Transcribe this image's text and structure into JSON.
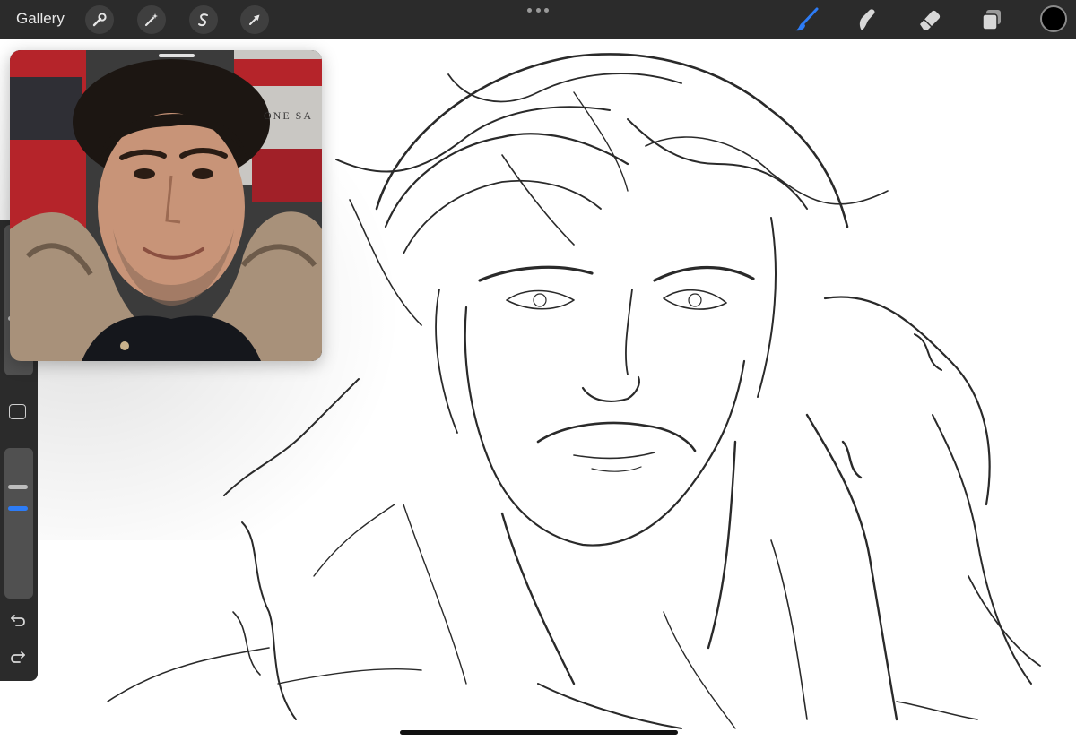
{
  "app": {
    "gallery_label": "Gallery"
  },
  "toolbar": {
    "left_tools": [
      {
        "name": "actions",
        "icon": "wrench-icon"
      },
      {
        "name": "adjustments",
        "icon": "magic-wand-icon"
      },
      {
        "name": "selection",
        "icon": "selection-s-icon"
      },
      {
        "name": "transform",
        "icon": "arrow-icon"
      }
    ],
    "right_tools": [
      {
        "name": "brush",
        "icon": "brush-icon",
        "active": true
      },
      {
        "name": "smudge",
        "icon": "smudge-icon"
      },
      {
        "name": "eraser",
        "icon": "eraser-icon"
      },
      {
        "name": "layers",
        "icon": "layers-icon"
      }
    ],
    "active_color": "#000000",
    "accent_color": "#2d7cf6"
  },
  "reference": {
    "sign_text": "ONE SA"
  },
  "sidebar": {
    "brush_size": 0.55,
    "opacity": 0.4
  }
}
